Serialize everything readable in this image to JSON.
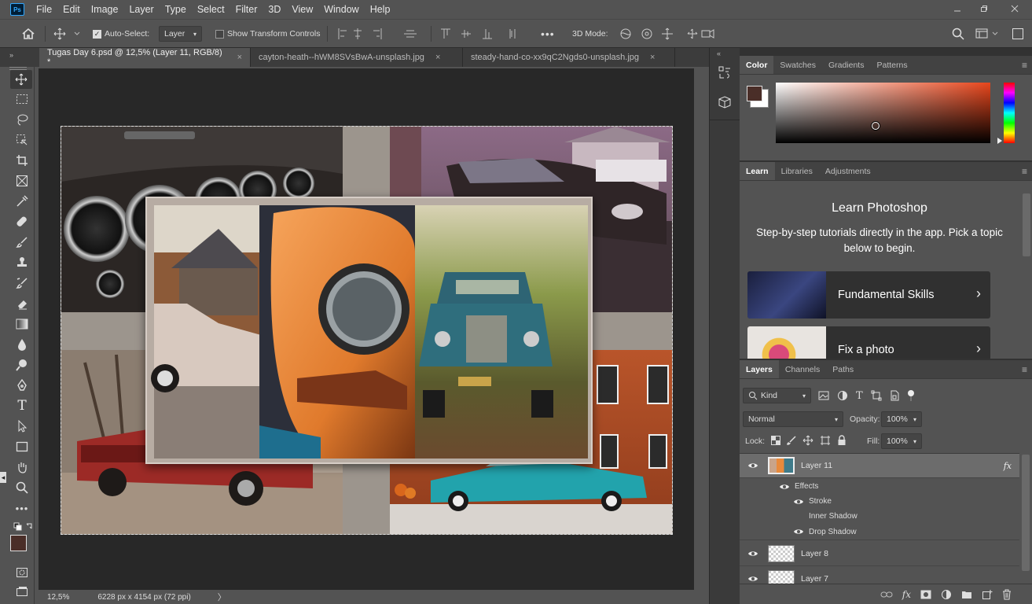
{
  "menu": [
    "File",
    "Edit",
    "Image",
    "Layer",
    "Type",
    "Select",
    "Filter",
    "3D",
    "View",
    "Window",
    "Help"
  ],
  "app_logo": "Ps",
  "options": {
    "auto_select_label": "Auto-Select:",
    "auto_select_value": "Layer",
    "show_transform_label": "Show Transform Controls",
    "mode_3d_label": "3D Mode:"
  },
  "tabs": [
    {
      "label": "Tugas Day 6.psd @ 12,5% (Layer 11, RGB/8) *",
      "active": true
    },
    {
      "label": "cayton-heath--hWM8SVsBwA-unsplash.jpg",
      "active": false
    },
    {
      "label": "steady-hand-co-xx9qC2Ngds0-unsplash.jpg",
      "active": false
    }
  ],
  "close_glyph": "×",
  "status": {
    "zoom": "12,5%",
    "doc_info": "6228 px x 4154 px (72 ppi)"
  },
  "color_panel": {
    "tabs": [
      "Color",
      "Swatches",
      "Gradients",
      "Patterns"
    ],
    "foreground": "#4a2e28",
    "background": "#ffffff",
    "hue_color": "#e8461c"
  },
  "learn_panel": {
    "tabs": [
      "Learn",
      "Libraries",
      "Adjustments"
    ],
    "title": "Learn Photoshop",
    "subtitle": "Step-by-step tutorials directly in the app. Pick a topic below to begin.",
    "lessons": [
      "Fundamental Skills",
      "Fix a photo"
    ]
  },
  "layers_panel": {
    "tabs": [
      "Layers",
      "Channels",
      "Paths"
    ],
    "filter_kind": "Kind",
    "blend_mode": "Normal",
    "opacity_label": "Opacity:",
    "opacity": "100%",
    "lock_label": "Lock:",
    "fill_label": "Fill:",
    "fill": "100%",
    "layers": [
      {
        "name": "Layer 11",
        "selected": true
      },
      {
        "name": "Layer 8",
        "selected": false
      },
      {
        "name": "Layer 7",
        "selected": false
      }
    ],
    "effects_label": "Effects",
    "effects": [
      {
        "name": "Stroke",
        "visible": true
      },
      {
        "name": "Inner Shadow",
        "visible": false
      },
      {
        "name": "Drop Shadow",
        "visible": true
      }
    ],
    "fx_badge": "fx"
  },
  "colors": {
    "accent": "#31a8ff",
    "panel": "#535353",
    "canvas_bg": "#282828"
  }
}
